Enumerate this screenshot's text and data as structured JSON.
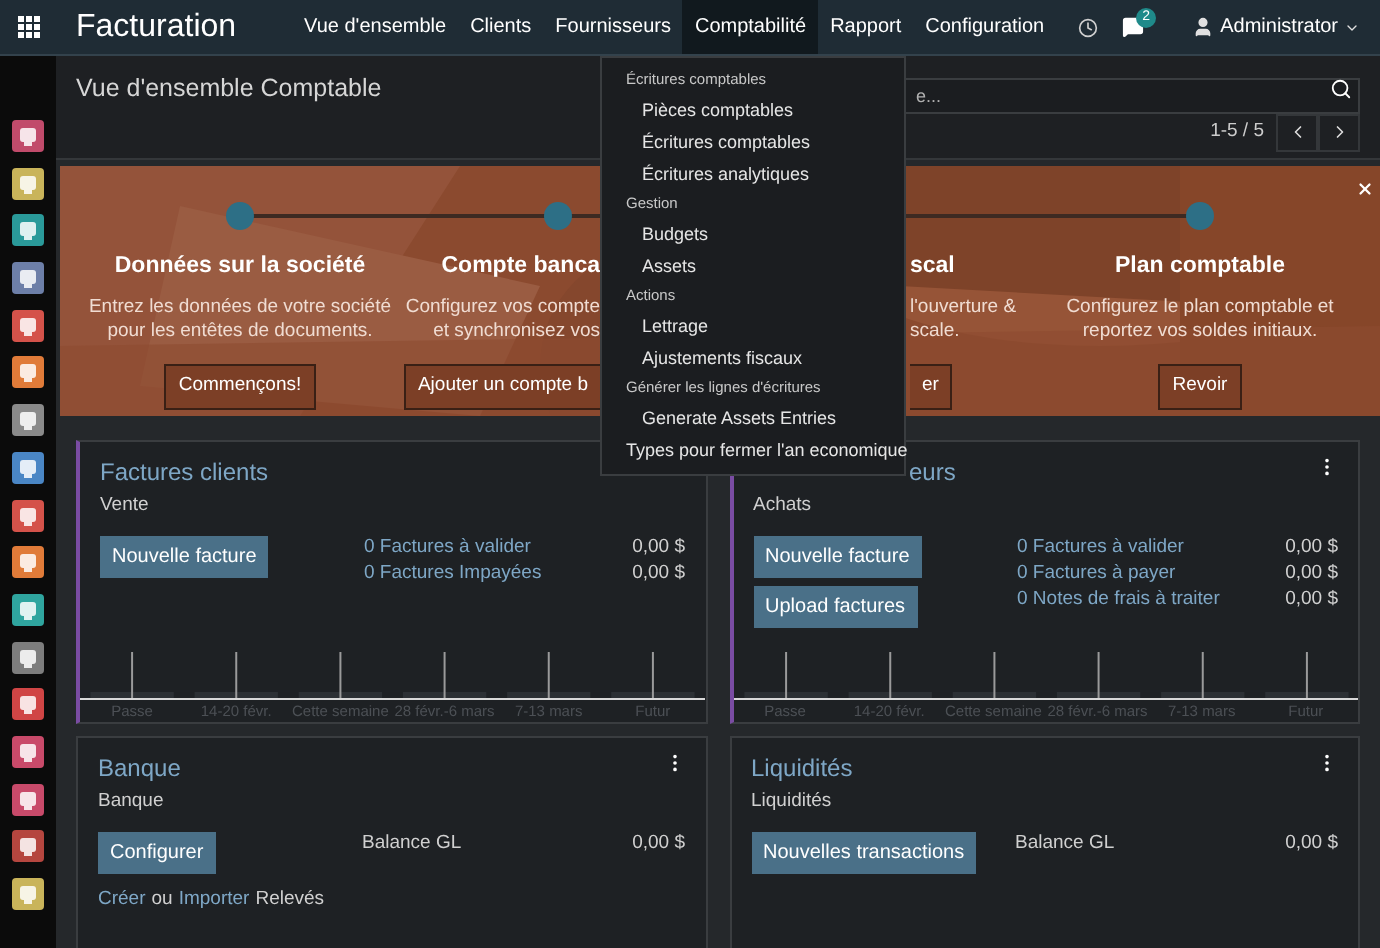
{
  "nav": {
    "brand": "Facturation",
    "menus": [
      {
        "label": "Vue d'ensemble",
        "selected": false
      },
      {
        "label": "Clients",
        "selected": false
      },
      {
        "label": "Fournisseurs",
        "selected": false
      },
      {
        "label": "Comptabilité",
        "selected": true
      },
      {
        "label": "Rapport",
        "selected": false
      },
      {
        "label": "Configuration",
        "selected": false
      }
    ],
    "chat_badge": "2",
    "user": "Administrator"
  },
  "sidebar": {
    "apps": [
      {
        "color": "#c14b6b"
      },
      {
        "color": "#c9b45a"
      },
      {
        "color": "#2a9a9a"
      },
      {
        "color": "#6d7fa8"
      },
      {
        "color": "#d4524a"
      },
      {
        "color": "#e07b39"
      },
      {
        "color": "#8a8a8a"
      },
      {
        "color": "#4a86c5"
      },
      {
        "color": "#d4524a"
      },
      {
        "color": "#e07b39"
      },
      {
        "color": "#2fa59f"
      },
      {
        "color": "#7d7d7d"
      },
      {
        "color": "#d04545"
      },
      {
        "color": "#c94a6a"
      },
      {
        "color": "#c84a6a"
      },
      {
        "color": "#b5463f"
      },
      {
        "color": "#c9b45a"
      }
    ]
  },
  "control_panel": {
    "title": "Vue d'ensemble Comptable",
    "search": {
      "placeholder": "e..."
    },
    "pager": "1-5 / 5"
  },
  "banner": {
    "steps": [
      {
        "kind": "full",
        "title": "Données sur la société",
        "description": [
          "Entrez les données de votre société",
          "pour les entêtes de documents."
        ],
        "button": "Commençons!"
      },
      {
        "kind": "cut_right",
        "title": "Compte banca",
        "description": [
          "Configurez vos compte",
          "et synchronisez vos"
        ],
        "button": "Ajouter un compte b"
      },
      {
        "kind": "cut_left",
        "title": "scal",
        "description": [
          "l'ouverture &",
          "scale."
        ],
        "button": "er"
      },
      {
        "kind": "full",
        "title": "Plan comptable",
        "description": [
          "Configurez le plan comptable et",
          "reportez vos soldes initiaux."
        ],
        "button": "Revoir"
      }
    ]
  },
  "dropdown": {
    "items": [
      {
        "kind": "header",
        "label": "Écritures comptables"
      },
      {
        "kind": "item",
        "label": "Pièces comptables"
      },
      {
        "kind": "item",
        "label": "Écritures comptables"
      },
      {
        "kind": "item",
        "label": "Écritures analytiques"
      },
      {
        "kind": "header",
        "label": "Gestion"
      },
      {
        "kind": "item",
        "label": "Budgets"
      },
      {
        "kind": "item",
        "label": "Assets"
      },
      {
        "kind": "header",
        "label": "Actions"
      },
      {
        "kind": "item",
        "label": "Lettrage"
      },
      {
        "kind": "item",
        "label": "Ajustements fiscaux"
      },
      {
        "kind": "header",
        "label": "Générer les lignes d'écritures"
      },
      {
        "kind": "item",
        "label": "Generate Assets Entries"
      },
      {
        "kind": "top",
        "label": "Types pour fermer l'an economique"
      }
    ]
  },
  "cards": [
    {
      "kind": "full",
      "title": "Factures clients",
      "subtitle": "Vente",
      "accent": true,
      "buttons": [
        "Nouvelle facture"
      ],
      "lines": [
        {
          "kind": "link",
          "label": "0 Factures à valider",
          "amount": "0,00 $"
        },
        {
          "kind": "link",
          "label": "0 Factures Impayées",
          "amount": "0,00 $"
        }
      ],
      "graph_labels": [
        "Passe",
        "14-20 févr.",
        "Cette semaine",
        "28 févr.-6 mars",
        "7-13 mars",
        "Futur"
      ]
    },
    {
      "kind": "covered",
      "title": "eurs",
      "subtitle": "Achats",
      "accent": true,
      "has_menu": true,
      "buttons": [
        "Nouvelle facture",
        "Upload factures"
      ],
      "lines": [
        {
          "kind": "link",
          "label": "0 Factures à valider",
          "amount": "0,00 $"
        },
        {
          "kind": "link",
          "label": "0 Factures à payer",
          "amount": "0,00 $"
        },
        {
          "kind": "link",
          "label": "0 Notes de frais à traiter",
          "amount": "0,00 $"
        }
      ],
      "graph_labels": [
        "Passe",
        "14-20 févr.",
        "Cette semaine",
        "28 févr.-6 mars",
        "7-13 mars",
        "Futur"
      ]
    },
    {
      "kind": "full",
      "title": "Banque",
      "subtitle": "Banque",
      "accent": false,
      "has_menu": true,
      "buttons": [
        "Configurer"
      ],
      "lines": [
        {
          "kind": "plain",
          "label": "Balance GL",
          "amount": "0,00 $"
        }
      ],
      "footer": [
        {
          "kind": "link",
          "text": "Créer"
        },
        {
          "kind": "text",
          "text": "ou"
        },
        {
          "kind": "link",
          "text": "Importer"
        },
        {
          "kind": "text",
          "text": "Relevés"
        }
      ]
    },
    {
      "kind": "full",
      "title": "Liquidités",
      "subtitle": "Liquidités",
      "accent": false,
      "has_menu": true,
      "buttons": [
        "Nouvelles transactions"
      ],
      "lines": [
        {
          "kind": "plain",
          "label": "Balance GL",
          "amount": "0,00 $"
        }
      ]
    }
  ]
}
